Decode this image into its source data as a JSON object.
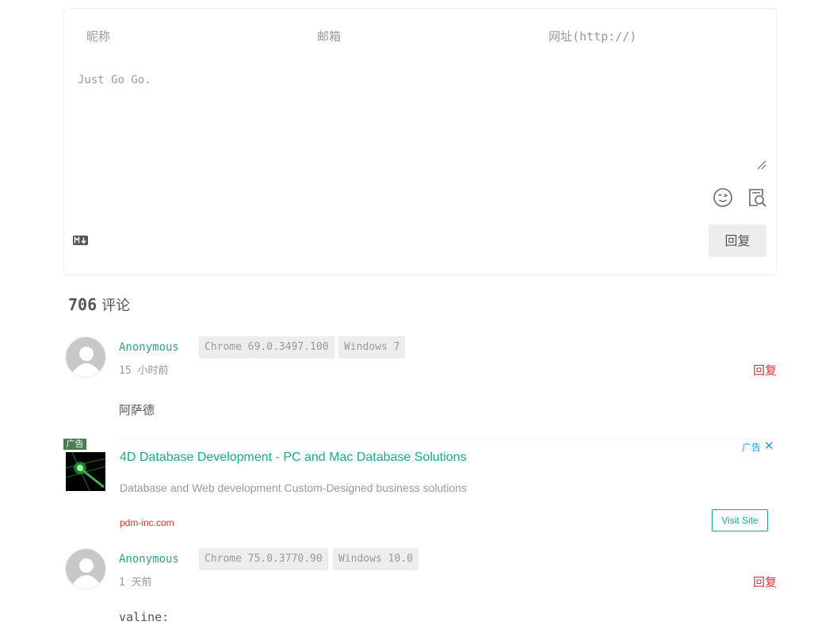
{
  "form": {
    "nick_placeholder": "昵称",
    "mail_placeholder": "邮箱",
    "link_placeholder": "网址(http://)",
    "textarea_placeholder": "Just Go Go.",
    "submit_label": "回复"
  },
  "comments_header": {
    "count": "706",
    "label": "评论"
  },
  "comments": [
    {
      "nick": "Anonymous",
      "browser": "Chrome 69.0.3497.100",
      "os": "Windows 7",
      "time_num": "15",
      "time_unit": "小时前",
      "reply_label": "回复",
      "content": "阿萨德"
    },
    {
      "nick": "Anonymous",
      "browser": "Chrome 75.0.3770.90",
      "os": "Windows 10.0",
      "time_num": "1",
      "time_unit": "天前",
      "reply_label": "回复",
      "content": "valine:"
    }
  ],
  "ad": {
    "tag": "广告",
    "title": "4D Database Development - PC and Mac Database Solutions",
    "description": "Database and Web development Custom-Designed business solutions",
    "url": "pdm-inc.com",
    "label": "广告",
    "close": "✕",
    "cta": "Visit Site"
  },
  "colors": {
    "nick": "#2aa888",
    "reply": "#dd3333",
    "ad_link": "#1aab8b",
    "ad_label": "#1c9fd9"
  }
}
